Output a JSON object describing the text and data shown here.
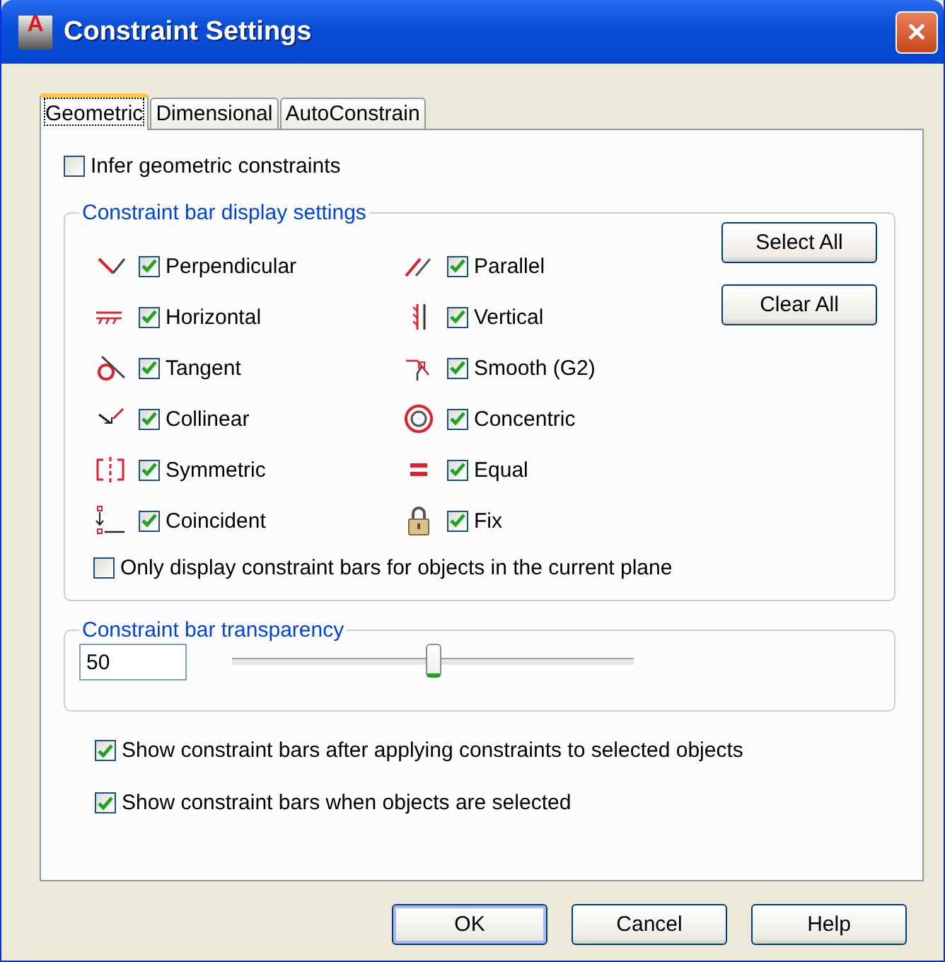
{
  "window": {
    "title": "Constraint Settings",
    "logo_letter": "A",
    "close": "✕"
  },
  "tabs": [
    {
      "label": "Geometric",
      "selected": true
    },
    {
      "label": "Dimensional",
      "selected": false
    },
    {
      "label": "AutoConstrain",
      "selected": false
    }
  ],
  "infer": {
    "label": "Infer geometric constraints",
    "checked": false
  },
  "display_group": {
    "title": "Constraint bar display settings",
    "constraints": [
      {
        "label": "Perpendicular",
        "checked": true
      },
      {
        "label": "Parallel",
        "checked": true
      },
      {
        "label": "Horizontal",
        "checked": true
      },
      {
        "label": "Vertical",
        "checked": true
      },
      {
        "label": "Tangent",
        "checked": true
      },
      {
        "label": "Smooth (G2)",
        "checked": true
      },
      {
        "label": "Collinear",
        "checked": true
      },
      {
        "label": "Concentric",
        "checked": true
      },
      {
        "label": "Symmetric",
        "checked": true
      },
      {
        "label": "Equal",
        "checked": true
      },
      {
        "label": "Coincident",
        "checked": true
      },
      {
        "label": "Fix",
        "checked": true
      }
    ],
    "buttons": [
      "Select All",
      "Clear All"
    ],
    "current_plane": {
      "label": "Only display constraint bars for objects in the current plane",
      "checked": false
    }
  },
  "transparency_group": {
    "title": "Constraint bar transparency",
    "value": "50",
    "level": 0.5
  },
  "options": [
    {
      "label": "Show constraint bars after applying constraints to selected objects",
      "checked": true
    },
    {
      "label": "Show constraint bars when objects are selected",
      "checked": true
    }
  ],
  "buttons": [
    {
      "label": "OK",
      "default": true
    },
    {
      "label": "Cancel",
      "default": false
    },
    {
      "label": "Help",
      "default": false
    }
  ]
}
